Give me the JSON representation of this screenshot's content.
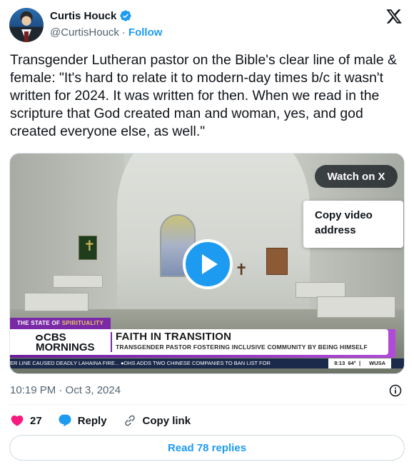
{
  "author": {
    "name": "Curtis Houck",
    "handle": "@CurtisHouck",
    "separator": "·",
    "follow_label": "Follow",
    "verified": true
  },
  "tweet": {
    "text": "Transgender Lutheran pastor on the Bible's clear line of male & female: \"It's hard to relate it to modern-day times b/c it wasn't written for 2024. It was written for then. When we read in the scripture that God created man and woman, yes, and god created everyone else, as well.\""
  },
  "video": {
    "watch_label": "Watch on X",
    "context_menu_item": "Copy video address",
    "banner_top_prefix": "THE STATE OF ",
    "banner_top_highlight": "SPIRITUALITY",
    "network_line1": "CBS",
    "network_line2": "MORNINGS",
    "headline": "FAITH IN TRANSITION",
    "subheadline": "TRANSGENDER PASTOR FOSTERING INCLUSIVE COMMUNITY BY BEING HIMSELF",
    "ticker_text": "ER LINE CAUSED DEADLY LAHAINA FIRE... ●DHS ADDS TWO CHINESE COMPANIES TO BAN LIST FOR",
    "ticker_time": "8:13",
    "ticker_temp": "64°",
    "ticker_station": "WUSA"
  },
  "meta": {
    "timestamp": "10:19 PM · Oct 3, 2024"
  },
  "actions": {
    "like_count": "27",
    "reply_label": "Reply",
    "copy_link_label": "Copy link",
    "read_replies_label": "Read 78 replies"
  },
  "colors": {
    "accent": "#1d9bf0",
    "like": "#f91880",
    "text": "#0f1419",
    "muted": "#536471"
  }
}
